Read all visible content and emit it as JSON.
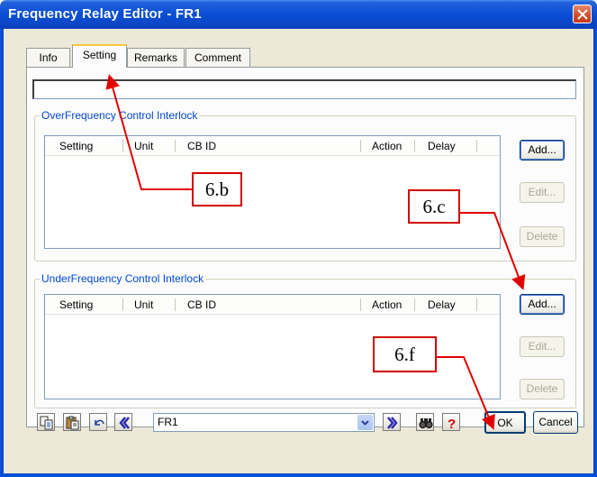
{
  "window": {
    "title": "Frequency Relay Editor - FR1"
  },
  "tabs": [
    {
      "label": "Info",
      "active": false
    },
    {
      "label": "Setting",
      "active": true
    },
    {
      "label": "Remarks",
      "active": false
    },
    {
      "label": "Comment",
      "active": false
    }
  ],
  "setting_input": {
    "value": ""
  },
  "over_group": {
    "label": "OverFrequency Control Interlock",
    "columns": [
      "Setting",
      "Unit",
      "CB ID",
      "Action",
      "Delay"
    ],
    "buttons": {
      "add": "Add...",
      "edit": "Edit...",
      "delete": "Delete"
    }
  },
  "under_group": {
    "label": "UnderFrequency Control Interlock",
    "columns": [
      "Setting",
      "Unit",
      "CB ID",
      "Action",
      "Delay"
    ],
    "buttons": {
      "add": "Add...",
      "edit": "Edit...",
      "delete": "Delete"
    }
  },
  "bottom": {
    "combo_value": "FR1",
    "ok_label": "OK",
    "cancel_label": "Cancel",
    "icons": [
      "copy-icon",
      "paste-icon",
      "undo-icon",
      "previous-icon",
      "next-icon",
      "find-icon",
      "help-icon"
    ]
  },
  "annotations": {
    "b": "6.b",
    "c": "6.c",
    "f": "6.f"
  },
  "colors": {
    "title_bar": "#0a4fd6",
    "dialog_bg": "#ece9d8",
    "group_label": "#0046d5",
    "callout_border": "#d00000",
    "active_tab_accent": "#ffc83c"
  }
}
